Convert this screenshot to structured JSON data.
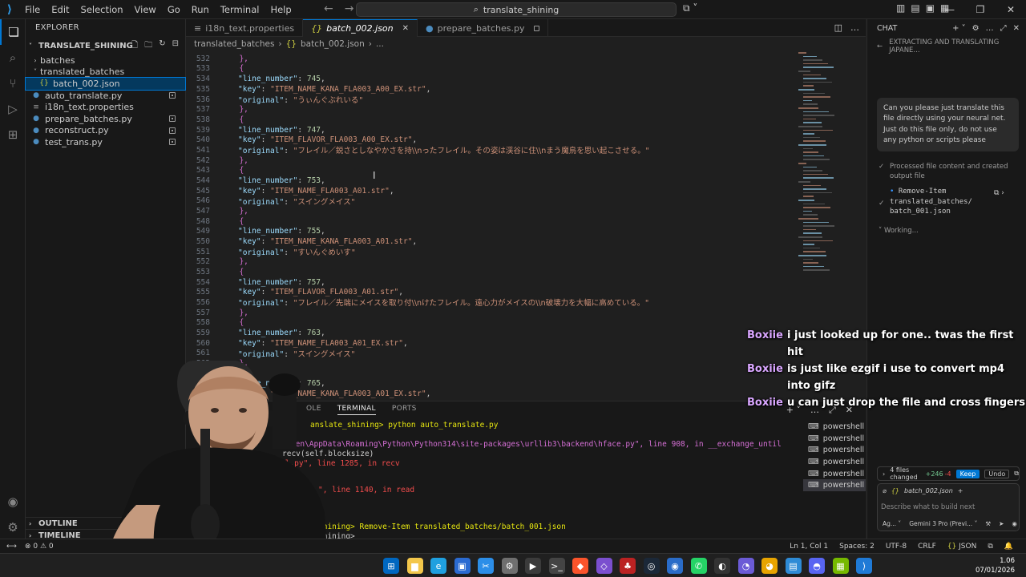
{
  "titlebar": {
    "menu": [
      "File",
      "Edit",
      "Selection",
      "View",
      "Go",
      "Run",
      "Terminal",
      "Help"
    ],
    "search_text": "translate_shining"
  },
  "explorer": {
    "title": "EXPLORER",
    "root": "TRANSLATE_SHINING",
    "items": [
      {
        "label": "batches",
        "kind": "folder",
        "expanded": false
      },
      {
        "label": "translated_batches",
        "kind": "folder",
        "expanded": true
      },
      {
        "label": "batch_002.json",
        "kind": "json",
        "selected": true
      },
      {
        "label": "auto_translate.py",
        "kind": "py",
        "modified": true
      },
      {
        "label": "i18n_text.properties",
        "kind": "props",
        "modified": false
      },
      {
        "label": "prepare_batches.py",
        "kind": "py",
        "modified": true
      },
      {
        "label": "reconstruct.py",
        "kind": "py",
        "modified": true
      },
      {
        "label": "test_trans.py",
        "kind": "py",
        "modified": true
      }
    ],
    "outline": "OUTLINE",
    "timeline": "TIMELINE"
  },
  "tabs": [
    {
      "label": "i18n_text.properties",
      "active": false
    },
    {
      "label": "batch_002.json",
      "active": true
    },
    {
      "label": "prepare_batches.py",
      "active": false
    }
  ],
  "breadcrumb": [
    "translated_batches",
    "batch_002.json",
    "..."
  ],
  "editor": {
    "lines": [
      {
        "n": "532",
        "t": "  },"
      },
      {
        "n": "533",
        "t": "  {"
      },
      {
        "n": "534",
        "key": "line_number",
        "num": "745"
      },
      {
        "n": "535",
        "key": "key",
        "str": "ITEM_NAME_KANA_FLA003_A00_EX.str",
        "comma": true
      },
      {
        "n": "536",
        "key": "original",
        "str": "うぃんぐぶれいる",
        "comma": false
      },
      {
        "n": "537",
        "t": "  },"
      },
      {
        "n": "538",
        "t": "  {"
      },
      {
        "n": "539",
        "key": "line_number",
        "num": "747"
      },
      {
        "n": "540",
        "key": "key",
        "str": "ITEM_FLAVOR_FLA003_A00_EX.str",
        "comma": true
      },
      {
        "n": "541",
        "key": "original",
        "str": "フレイル／鋭さとしなやかさを持\\\\nったフレイル。その姿は渓谷に住\\\\nまう魔鳥を思い起こさせる。",
        "comma": false
      },
      {
        "n": "542",
        "t": "  },"
      },
      {
        "n": "543",
        "t": "  {"
      },
      {
        "n": "544",
        "key": "line_number",
        "num": "753"
      },
      {
        "n": "545",
        "key": "key",
        "str": "ITEM_NAME_FLA003_A01.str",
        "comma": true
      },
      {
        "n": "546",
        "key": "original",
        "str": "スイングメイス",
        "comma": false
      },
      {
        "n": "547",
        "t": "  },"
      },
      {
        "n": "548",
        "t": "  {"
      },
      {
        "n": "549",
        "key": "line_number",
        "num": "755"
      },
      {
        "n": "550",
        "key": "key",
        "str": "ITEM_NAME_KANA_FLA003_A01.str",
        "comma": true
      },
      {
        "n": "551",
        "key": "original",
        "str": "すいんぐめいす",
        "comma": false
      },
      {
        "n": "552",
        "t": "  },"
      },
      {
        "n": "553",
        "t": "  {"
      },
      {
        "n": "554",
        "key": "line_number",
        "num": "757"
      },
      {
        "n": "555",
        "key": "key",
        "str": "ITEM_FLAVOR_FLA003_A01.str",
        "comma": true
      },
      {
        "n": "556",
        "key": "original",
        "str": "フレイル／先端にメイスを取り付\\\\nけたフレイル。遠心力がメイスの\\\\n破壊力を大幅に高めている。",
        "comma": false
      },
      {
        "n": "557",
        "t": "  },"
      },
      {
        "n": "558",
        "t": "  {"
      },
      {
        "n": "559",
        "key": "line_number",
        "num": "763"
      },
      {
        "n": "560",
        "key": "key",
        "str": "ITEM_NAME_FLA003_A01_EX.str",
        "comma": true
      },
      {
        "n": "561",
        "key": "original",
        "str": "スイングメイス",
        "comma": false
      },
      {
        "n": "562",
        "t": "  },"
      },
      {
        "n": "563",
        "t": "  {"
      },
      {
        "n": "564",
        "key": "line_number",
        "num": "765"
      },
      {
        "n": "565",
        "key": "key",
        "str": "ITEM_NAME_KANA_FLA003_A01_EX.str",
        "comma": true
      }
    ]
  },
  "panel": {
    "tabs": [
      "OLE",
      "TERMINAL",
      "PORTS"
    ],
    "active_tab": "TERMINAL",
    "lines": [
      {
        "text": "anslate_shining> python auto_translate.py",
        "cls": "t-yel-cmd"
      },
      {
        "text": "",
        "cls": ""
      },
      {
        "text": "aiRyzen\\AppData\\Roaming\\Python\\Python314\\site-packages\\urllib3\\backend\\hface.py\", line 908, in __exchange_until",
        "cls": "t-mag"
      },
      {
        "text": "recv(self.blocksize)",
        "cls": ""
      },
      {
        "text": "sl.py\", line 1285, in recv",
        "cls": "t-red-mix"
      },
      {
        "text": "",
        "cls": ""
      },
      {
        "text": "\", line 1140, in read",
        "cls": "t-red-mix"
      },
      {
        "text": "shining> Remove-Item translated_batches/batch_001.json",
        "cls": "t-yel-cmd2"
      },
      {
        "text": "shining> ",
        "cls": ""
      }
    ],
    "terminals": [
      "powershell",
      "powershell",
      "powershell",
      "powershell",
      "powershell",
      "powershell"
    ]
  },
  "chat": {
    "title": "CHAT",
    "session_title": "EXTRACTING AND TRANSLATING JAPANE...",
    "user_message": "Can you please just translate this file directly using your neural net. Just do this file only, do not use any python or scripts please",
    "processed": "Processed file content and created output file",
    "tool_cmd": "Remove-Item translated_batches/ batch_001.json",
    "working": "Working...",
    "changes": "4 files changed",
    "added": "+246",
    "removed": "-4",
    "keep": "Keep",
    "undo": "Undo",
    "context_file": "batch_002.json",
    "placeholder": "Describe what to build next",
    "agent": "Ag...",
    "model": "Gemini 3 Pro (Previ..."
  },
  "overlay": [
    {
      "user": "Boxiie",
      "msg": "i just looked up for one.. twas the first hit"
    },
    {
      "user": "Boxiie",
      "msg": "is just like ezgif i use to convert mp4 into gifz"
    },
    {
      "user": "Boxiie",
      "msg": "u can just drop the file and cross fingers"
    }
  ],
  "statusbar": {
    "errors": "0",
    "warnings": "0",
    "position": "Ln 1, Col 1",
    "spaces": "Spaces: 2",
    "encoding": "UTF-8",
    "eol": "CRLF",
    "language": "JSON"
  },
  "taskbar": {
    "time": "1.06",
    "date": "07/01/2026"
  },
  "colors": {
    "accent": "#0078d4",
    "overlay_user": "#d9a6ff"
  }
}
